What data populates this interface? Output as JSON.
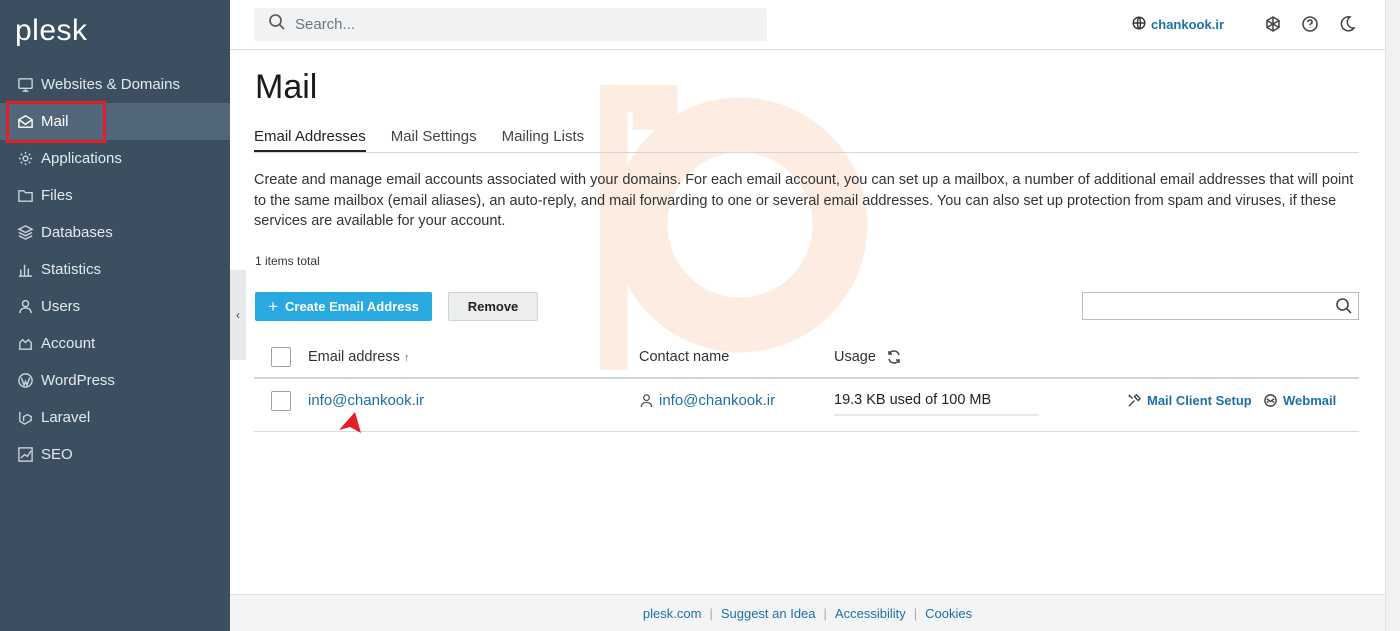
{
  "brand": {
    "logo": "plesk"
  },
  "sidebar": {
    "items": [
      {
        "label": "Websites & Domains",
        "icon": "monitor-icon"
      },
      {
        "label": "Mail",
        "icon": "envelope-icon",
        "active": true
      },
      {
        "label": "Applications",
        "icon": "gear-icon"
      },
      {
        "label": "Files",
        "icon": "folder-icon"
      },
      {
        "label": "Databases",
        "icon": "database-icon"
      },
      {
        "label": "Statistics",
        "icon": "bar-chart-icon"
      },
      {
        "label": "Users",
        "icon": "user-icon"
      },
      {
        "label": "Account",
        "icon": "account-icon"
      },
      {
        "label": "WordPress",
        "icon": "wordpress-icon"
      },
      {
        "label": "Laravel",
        "icon": "laravel-icon"
      },
      {
        "label": "SEO",
        "icon": "seo-chart-icon"
      }
    ]
  },
  "topbar": {
    "search_placeholder": "Search...",
    "domain": "chankook.ir"
  },
  "main": {
    "title": "Mail",
    "tabs": [
      {
        "label": "Email Addresses",
        "active": true
      },
      {
        "label": "Mail Settings"
      },
      {
        "label": "Mailing Lists"
      }
    ],
    "description": "Create and manage email accounts associated with your domains. For each email account, you can set up a mailbox, a number of additional email addresses that will point to the same mailbox (email aliases), an auto-reply, and mail forwarding to one or several email addresses. You can also set up protection from spam and viruses, if these services are available for your account.",
    "items_total": "1 items total",
    "create_button": "Create Email Address",
    "remove_button": "Remove",
    "table": {
      "columns": [
        "Email address",
        "Contact name",
        "Usage"
      ],
      "rows": [
        {
          "email": "info@chankook.ir",
          "contact": "info@chankook.ir",
          "usage": "19.3 KB used of 100 MB",
          "usage_fraction": 0.0002,
          "actions": [
            "Mail Client Setup",
            "Webmail"
          ]
        }
      ]
    }
  },
  "footer": {
    "links": [
      "plesk.com",
      "Suggest an Idea",
      "Accessibility",
      "Cookies"
    ]
  },
  "colors": {
    "sidebar_bg": "#3b4f61",
    "accent": "#28aae1",
    "link": "#1d6fa6",
    "highlight": "#e3202a"
  }
}
